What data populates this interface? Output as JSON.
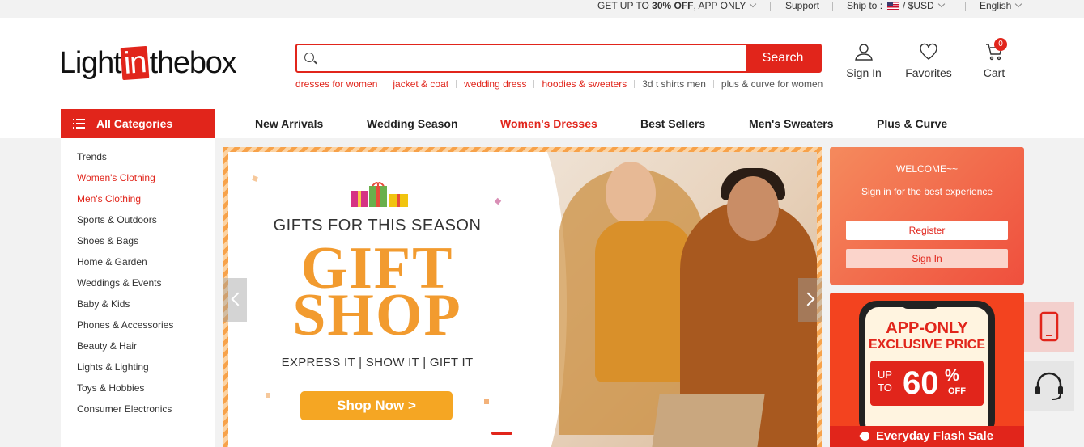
{
  "topbar": {
    "promo_prefix": "GET UP TO ",
    "promo_bold": "30% OFF",
    "promo_suffix": ", APP ONLY",
    "support": "Support",
    "ship_to": "Ship to :",
    "currency": "/  $USD",
    "language": "English"
  },
  "logo": {
    "part1": "Light",
    "part2": "in",
    "part3": "thebox"
  },
  "search": {
    "placeholder": "",
    "button": "Search",
    "hotwords": [
      "dresses for women",
      "jacket & coat",
      "wedding dress",
      "hoodies & sweaters",
      "3d t shirts men",
      "plus & curve for women"
    ]
  },
  "header_actions": {
    "signin": "Sign In",
    "favorites": "Favorites",
    "cart": "Cart",
    "cart_count": "0"
  },
  "nav": {
    "all_categories": "All Categories",
    "links": [
      "New Arrivals",
      "Wedding Season",
      "Women's Dresses",
      "Best Sellers",
      "Men's Sweaters",
      "Plus & Curve"
    ],
    "active": "Women's Dresses"
  },
  "categories": [
    "Trends",
    "Women's Clothing",
    "Men's Clothing",
    "Sports & Outdoors",
    "Shoes & Bags",
    "Home & Garden",
    "Weddings & Events",
    "Baby & Kids",
    "Phones & Accessories",
    "Beauty & Hair",
    "Lights & Lighting",
    "Toys & Hobbies",
    "Consumer Electronics"
  ],
  "banner": {
    "subtitle": "GIFTS FOR THIS SEASON",
    "title_line1": "GIFT",
    "title_line2": "SHOP",
    "tagline": "EXPRESS IT | SHOW IT | GIFT IT",
    "cta": "Shop Now >"
  },
  "welcome": {
    "title": "WELCOME~~",
    "subtitle": "Sign in for the best experience",
    "register": "Register",
    "signin": "Sign In"
  },
  "app_promo": {
    "line1": "APP-ONLY",
    "line2": "EXCLUSIVE PRICE",
    "up": "UP",
    "to": "TO",
    "percent": "60",
    "percent_sign": "%",
    "off": "OFF",
    "flash": "Everyday Flash Sale"
  },
  "colors": {
    "brand_red": "#e1251b",
    "banner_orange": "#f29b2f",
    "cta_orange": "#f5a623"
  }
}
